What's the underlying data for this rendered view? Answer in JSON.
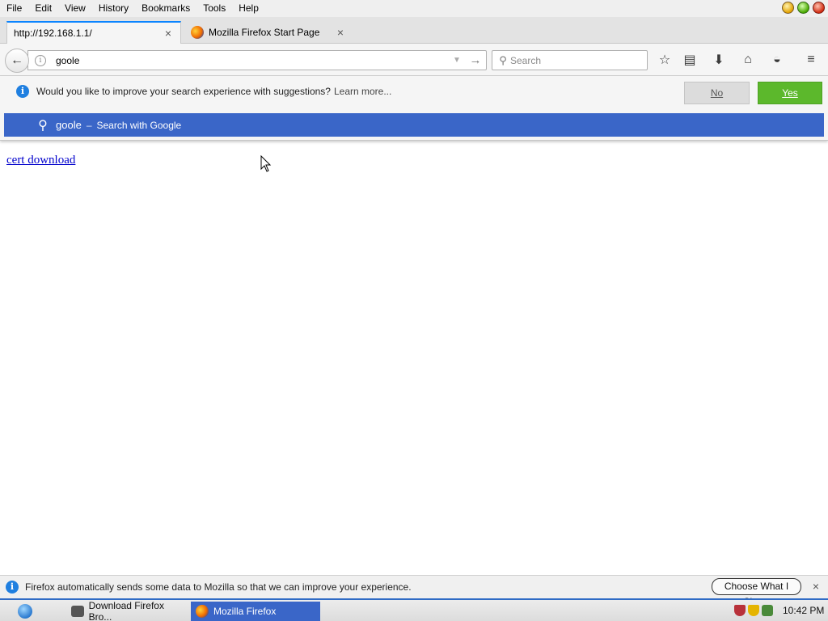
{
  "menubar": {
    "items": [
      {
        "label": "File"
      },
      {
        "label": "Edit"
      },
      {
        "label": "View"
      },
      {
        "label": "History"
      },
      {
        "label": "Bookmarks"
      },
      {
        "label": "Tools"
      },
      {
        "label": "Help"
      }
    ]
  },
  "tabs": [
    {
      "label": "http://192.168.1.1/",
      "active": true
    },
    {
      "label": "Mozilla Firefox Start Page",
      "active": false
    }
  ],
  "navbar": {
    "url_value": "goole",
    "search_placeholder": "Search"
  },
  "suggestions_popup": {
    "notice_text": "Would you like to improve your search experience with suggestions?",
    "learn_more": "Learn more...",
    "no_label": "No",
    "yes_label": "Yes",
    "row_term": "goole",
    "row_separator": "–",
    "row_action": "Search with Google"
  },
  "page": {
    "link_text": "cert download"
  },
  "databar": {
    "text": "Firefox automatically sends some data to Mozilla so that we can improve your experience.",
    "choose_label": "Choose What I Share",
    "close_glyph": "×"
  },
  "taskbar": {
    "items": [
      {
        "label": "Download Firefox Bro..."
      },
      {
        "label": "Mozilla Firefox"
      }
    ],
    "clock": "10:42 PM"
  },
  "colors": {
    "accent_blue": "#3a66c8",
    "yes_green": "#5cb82c",
    "link_blue": "#0000cc"
  },
  "icons": {
    "tab_close": "×",
    "new_tab": "+",
    "back": "←",
    "go": "→",
    "dropmarker": "▼",
    "search": "⚲",
    "bookmark_star": "☆",
    "reading_list": "▤",
    "downloads": "⬇",
    "home": "⌂",
    "pocket": "◒",
    "menu": "≡",
    "info": "i"
  }
}
